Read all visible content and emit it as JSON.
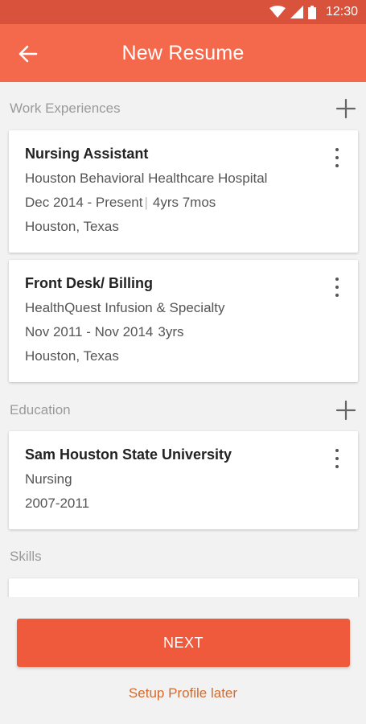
{
  "status_bar": {
    "time": "12:30"
  },
  "app_bar": {
    "title": "New Resume"
  },
  "work": {
    "label": "Work Experiences",
    "items": [
      {
        "title": "Nursing Assistant",
        "company": "Houston Behavioral Healthcare Hospital",
        "dates": "Dec 2014 - Present",
        "duration": "4yrs 7mos",
        "location": "Houston, Texas"
      },
      {
        "title": "Front Desk/ Billing",
        "company": "HealthQuest Infusion & Specialty",
        "dates": "Nov 2011 - Nov 2014",
        "duration": "3yrs",
        "location": "Houston, Texas"
      }
    ]
  },
  "education": {
    "label": "Education",
    "items": [
      {
        "school": "Sam Houston State University",
        "field": "Nursing",
        "years": "2007-2011"
      }
    ]
  },
  "skills": {
    "label": "Skills"
  },
  "actions": {
    "next_label": "NEXT",
    "later_label": "Setup Profile later"
  },
  "colors": {
    "primary": "#f4694c",
    "status_bar": "#d9533c",
    "button": "#ef5a3d",
    "link": "#d66a2c"
  }
}
